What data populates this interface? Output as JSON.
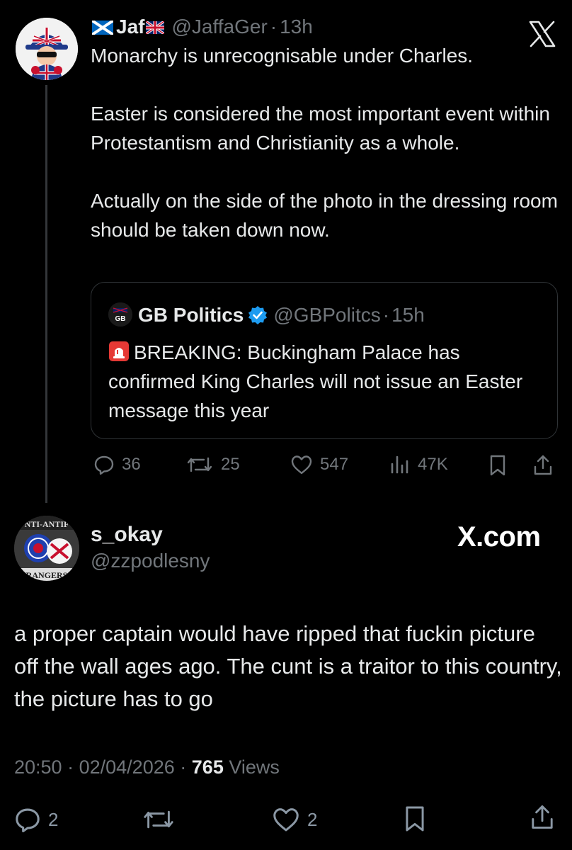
{
  "tweet": {
    "author_name": "Jaf",
    "handle": "@JaffaGer",
    "separator": "·",
    "time_ago": "13h",
    "paragraphs": [
      "Monarchy is unrecognisable under Charles.",
      "Easter is considered the most important event within Protestantism and Christianity as a whole.",
      "Actually on the side of the photo in the dressing room should be taken down now."
    ],
    "actions": {
      "replies": "36",
      "reposts": "25",
      "likes": "547",
      "views": "47K"
    }
  },
  "quote": {
    "logo_text": "GB",
    "author_name": "GB Politics",
    "handle": "@GBPolitcs",
    "separator": "·",
    "time_ago": "15h",
    "text": "BREAKING: Buckingham Palace has confirmed King Charles will not issue an Easter message this year"
  },
  "reply": {
    "author_name": "s_okay",
    "handle": "@zzpodlesny",
    "watermark": "X.com",
    "avatar_text_top": "NTI-ANTIF",
    "avatar_text_bottom": "RANGERS",
    "text": "a proper captain would have ripped that fuckin picture off the wall ages ago. The cunt is a traitor to this country, the picture has to go",
    "time": "20:50",
    "date": "02/04/2026",
    "separator": "·",
    "views_count": "765",
    "views_label": "Views",
    "actions": {
      "replies": "2",
      "likes": "2"
    }
  },
  "colors": {
    "background": "#000000",
    "text_primary": "#e7e9ea",
    "text_muted": "#71767b",
    "verified_blue": "#1d9bf0",
    "border": "#2f3336"
  }
}
